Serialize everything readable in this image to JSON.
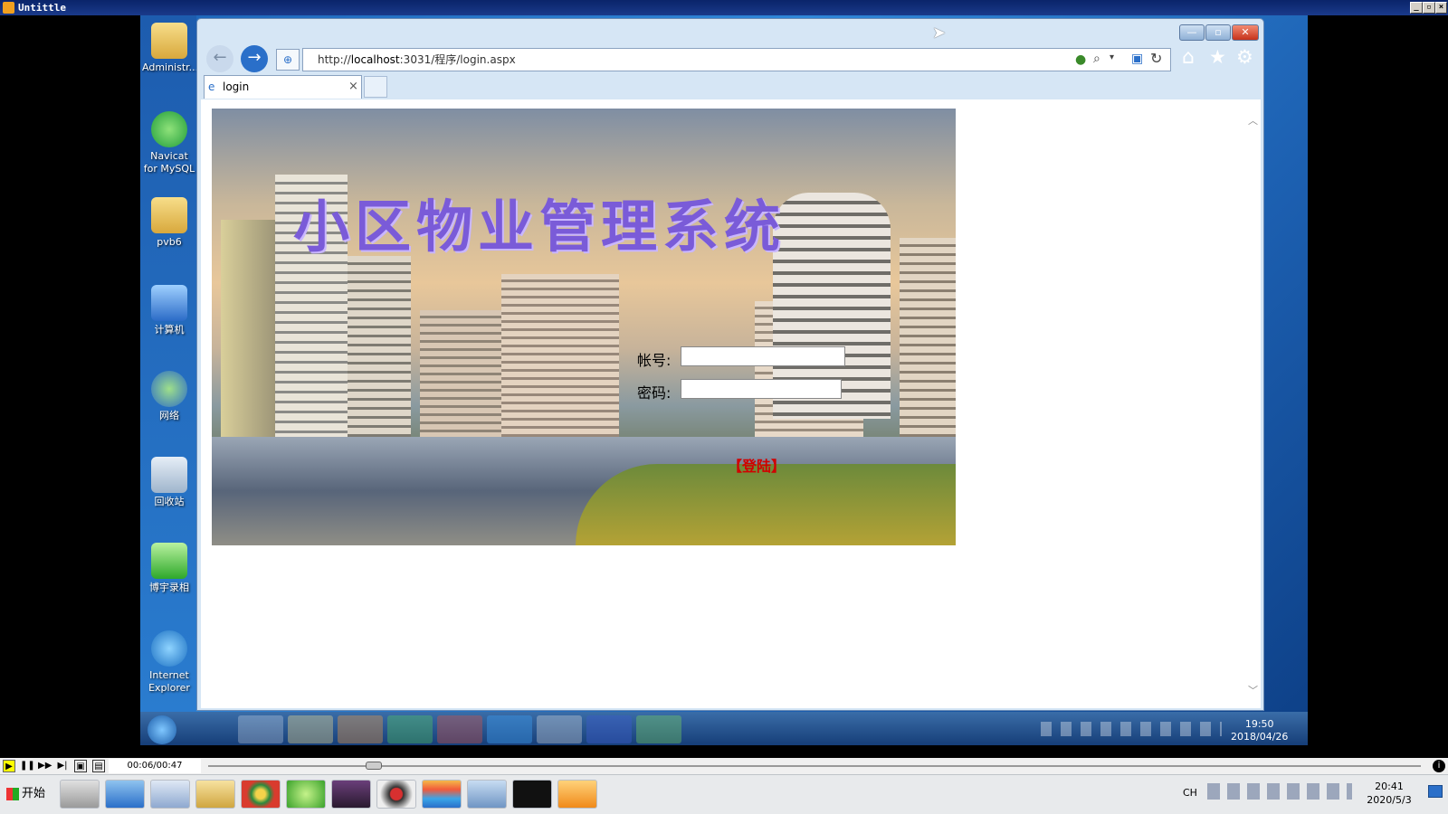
{
  "player": {
    "title": "Untittle",
    "time": "00:06/00:47",
    "progress": 0.13
  },
  "desktop_icons": [
    {
      "label": "Administr...",
      "icon": "folder-icon"
    },
    {
      "label": "Navicat for MySQL",
      "icon": "navicat-icon"
    },
    {
      "label": "pvb6",
      "icon": "folder-icon"
    },
    {
      "label": "计算机",
      "icon": "computer-icon"
    },
    {
      "label": "网络",
      "icon": "network-icon"
    },
    {
      "label": "回收站",
      "icon": "recycle-bin-icon"
    },
    {
      "label": "博宇录相",
      "icon": "recorder-icon"
    },
    {
      "label": "Internet Explorer",
      "icon": "ie-icon"
    }
  ],
  "browser": {
    "url_prefix": "http://",
    "url_host": "localhost",
    "url_rest": ":3031/程序/login.aspx",
    "tab_label": "login"
  },
  "login": {
    "banner_title": "小区物业管理系统",
    "account_label": "帐号:",
    "password_label": "密码:",
    "account_value": "",
    "password_value": "",
    "login_button": "【登陆】"
  },
  "inner_taskbar": {
    "time": "19:50",
    "date": "2018/04/26"
  },
  "host_taskbar": {
    "start_label": "开始",
    "lang": "CH",
    "time": "20:41",
    "date": "2020/5/3"
  }
}
